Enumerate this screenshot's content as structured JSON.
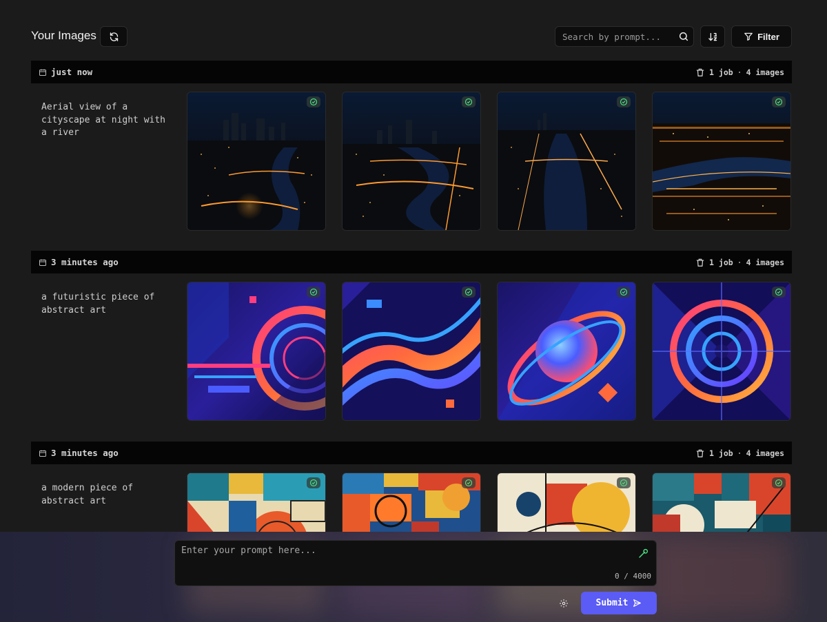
{
  "header": {
    "title": "Your Images",
    "search_placeholder": "Search by prompt...",
    "filter_label": "Filter"
  },
  "groups": [
    {
      "time": "just now",
      "jobs": "1 job",
      "images": "4 images",
      "prompt": "Aerial view of a cityscape at night with a river"
    },
    {
      "time": "3 minutes ago",
      "jobs": "1 job",
      "images": "4 images",
      "prompt": "a futuristic piece of abstract art"
    },
    {
      "time": "3 minutes ago",
      "jobs": "1 job",
      "images": "4 images",
      "prompt": "a modern piece of abstract art"
    }
  ],
  "composer": {
    "placeholder": "Enter your prompt here...",
    "counter": "0 / 4000",
    "submit_label": "Submit"
  },
  "colors": {
    "accent": "#5b5bf5",
    "success": "#4ade80",
    "background": "#1b1b1b"
  }
}
